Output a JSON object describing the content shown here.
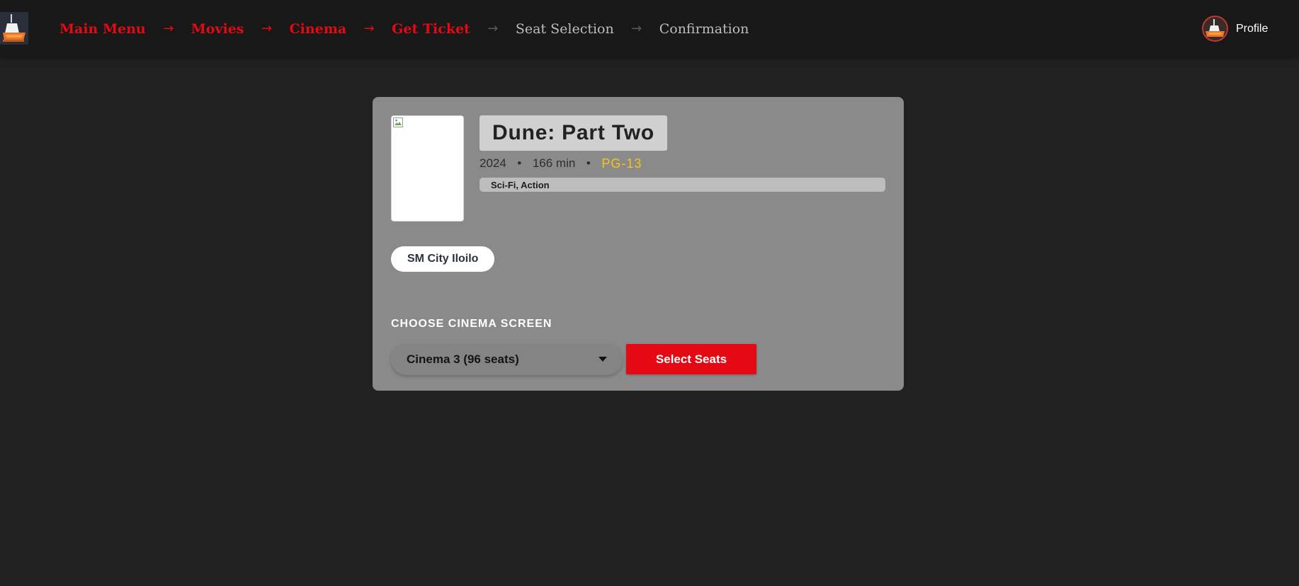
{
  "header": {
    "breadcrumb": [
      {
        "label": "Main Menu",
        "state": "active"
      },
      {
        "label": "Movies",
        "state": "active"
      },
      {
        "label": "Cinema",
        "state": "active"
      },
      {
        "label": "Get Ticket",
        "state": "active"
      },
      {
        "label": "Seat Selection",
        "state": "inactive"
      },
      {
        "label": "Confirmation",
        "state": "inactive"
      }
    ],
    "separator": "→",
    "profile_label": "Profile"
  },
  "movie": {
    "title": "Dune: Part Two",
    "year": "2024",
    "duration": "166 min",
    "meta_separator": "•",
    "rating": "PG-13",
    "genres": "Sci-Fi, Action"
  },
  "venue": {
    "name": "SM City Iloilo"
  },
  "screen_selection": {
    "label": "CHOOSE CINEMA SCREEN",
    "selected": "Cinema 3 (96 seats)",
    "button_label": "Select Seats"
  },
  "colors": {
    "accent": "#e50914",
    "rating": "#f5c518",
    "background": "#212121",
    "header": "#181818",
    "card": "#8a8a8a"
  },
  "icons": {
    "logo": "cinema-logo-icon",
    "avatar": "profile-avatar-icon",
    "poster": "broken-image-icon",
    "dropdown": "chevron-down-icon"
  }
}
